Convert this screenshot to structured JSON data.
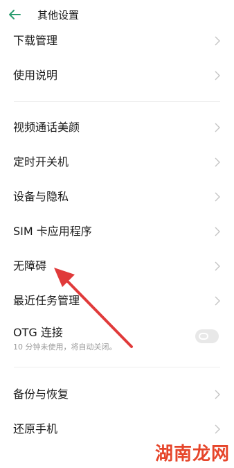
{
  "header": {
    "title": "其他设置",
    "back_icon": "back-arrow-icon",
    "accent_color": "#2a9d6f"
  },
  "groups": [
    {
      "items": [
        {
          "label": "下载管理",
          "icon": "chevron-right-icon"
        },
        {
          "label": "使用说明",
          "icon": "chevron-right-icon"
        }
      ]
    },
    {
      "items": [
        {
          "label": "视频通话美颜",
          "icon": "chevron-right-icon"
        },
        {
          "label": "定时开关机",
          "icon": "chevron-right-icon"
        },
        {
          "label": "设备与隐私",
          "icon": "chevron-right-icon"
        },
        {
          "label": "SIM 卡应用程序",
          "icon": "chevron-right-icon"
        },
        {
          "label": "无障碍",
          "icon": "chevron-right-icon"
        },
        {
          "label": "最近任务管理",
          "icon": "chevron-right-icon"
        }
      ]
    },
    {
      "items": [
        {
          "label": "OTG 连接",
          "sublabel": "10 分钟未使用，将自动关闭。",
          "toggle_state": "off"
        }
      ]
    },
    {
      "items": [
        {
          "label": "备份与恢复",
          "icon": "chevron-right-icon"
        },
        {
          "label": "还原手机",
          "icon": "chevron-right-icon"
        }
      ]
    }
  ],
  "annotation": {
    "color": "#e03a3a",
    "icon": "red-arrow-annotation"
  },
  "watermark": {
    "text": "湖南龙网",
    "color": "#e6452a"
  }
}
